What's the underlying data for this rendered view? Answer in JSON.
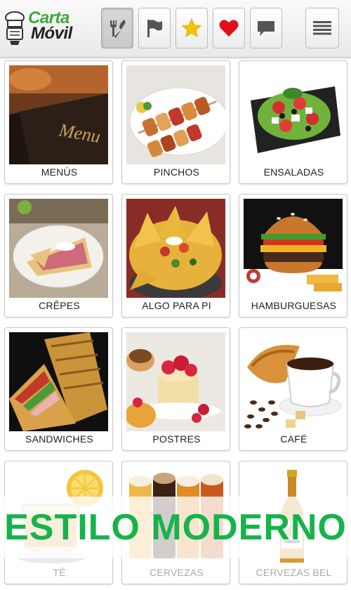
{
  "app": {
    "logo_line1": "Carta",
    "logo_line2": "Móvil",
    "brand_color": "#3ea83a"
  },
  "toolbar": {
    "buttons": [
      {
        "icon": "fork-knife-icon",
        "active": true
      },
      {
        "icon": "flag-icon",
        "active": false
      },
      {
        "icon": "star-icon",
        "color": "#f3c300"
      },
      {
        "icon": "heart-icon",
        "color": "#e0111c"
      },
      {
        "icon": "chat-bubble-icon"
      },
      {
        "icon": "hamburger-menu-icon"
      }
    ]
  },
  "categories": [
    {
      "label": "MENÚS"
    },
    {
      "label": "PINCHOS"
    },
    {
      "label": "ENSALADAS"
    },
    {
      "label": "CRÊPES"
    },
    {
      "label": "ALGO PARA PI"
    },
    {
      "label": "HAMBURGUESAS"
    },
    {
      "label": "SANDWICHES"
    },
    {
      "label": "POSTRES"
    },
    {
      "label": "CAFÉ"
    },
    {
      "label": "TÉ"
    },
    {
      "label": "CERVEZAS"
    },
    {
      "label": "CERVEZAS BEL"
    }
  ],
  "banner": {
    "text": "ESTILO MODERNO",
    "color": "#17b34a"
  }
}
